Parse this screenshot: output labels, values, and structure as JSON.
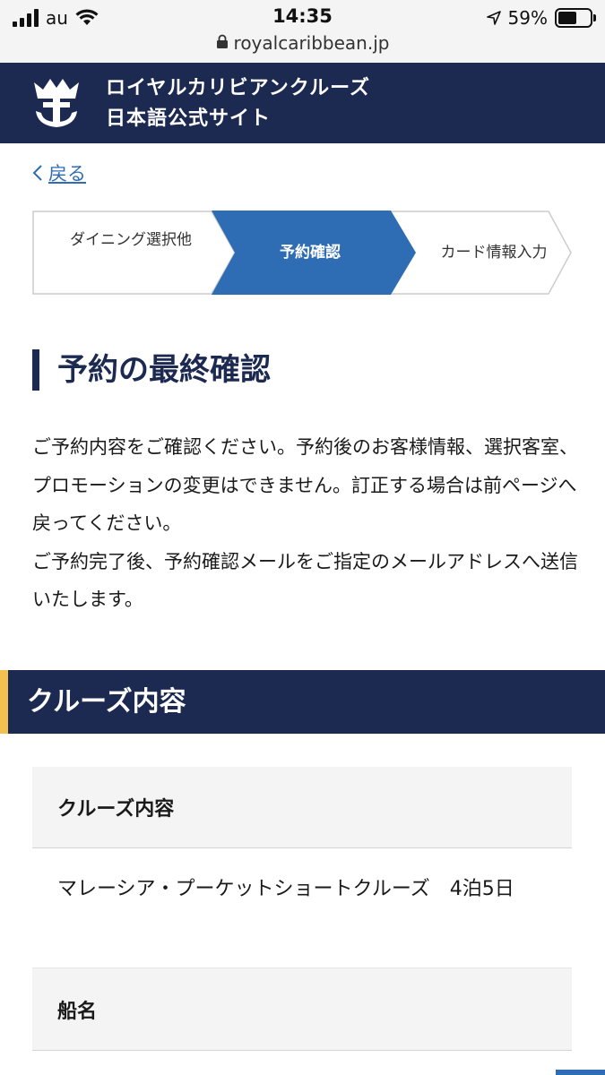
{
  "status_bar": {
    "carrier": "au",
    "time": "14:35",
    "battery": "59%",
    "battery_level": 0.59,
    "url": "royalcaribbean.jp"
  },
  "brand": {
    "line1": "ロイヤルカリビアンクルーズ",
    "line2": "日本語公式サイト",
    "logo_icon": "crown-anchor-logo"
  },
  "back_link": "戻る",
  "stepper": {
    "steps": [
      {
        "label": "ダイニング選択他",
        "active": false
      },
      {
        "label": "予約確認",
        "active": true
      },
      {
        "label": "カード情報入力",
        "active": false
      }
    ]
  },
  "page_title": "予約の最終確認",
  "intro": {
    "paragraph1": "ご予約内容をご確認ください。予約後のお客様情報、選択客室、プロモーションの変更はできません。訂正する場合は前ページへ戻ってください。",
    "paragraph2": "ご予約完了後、予約確認メールをご指定のメールアドレスへ送信いたします。"
  },
  "section": {
    "title": "クルーズ内容",
    "rows": [
      {
        "label": "クルーズ内容",
        "value": "マレーシア・プーケットショートクルーズ　4泊5日"
      },
      {
        "label": "船名",
        "value": ""
      }
    ]
  },
  "colors": {
    "navy": "#1c2951",
    "accent_blue": "#2e6db4",
    "accent_yellow": "#f2c14e"
  }
}
